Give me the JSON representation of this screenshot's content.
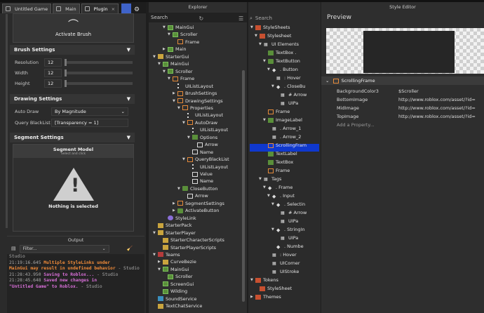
{
  "doc_tabs": [
    "Untitled Game",
    "Main",
    "Plugin"
  ],
  "brush": {
    "activate_label": "Activate Brush"
  },
  "sections": {
    "brush_settings": "Brush Settings",
    "drawing_settings": "Drawing Settings",
    "segment_settings": "Segment Settings"
  },
  "brush_settings": [
    {
      "label": "Resolution",
      "value": "12"
    },
    {
      "label": "Width",
      "value": "12"
    },
    {
      "label": "Height",
      "value": "12"
    }
  ],
  "drawing_settings": {
    "auto_draw_label": "Auto Draw",
    "auto_draw_value": "By Magnitude",
    "query_label": "Query BlackList",
    "query_value": "[Transparency = 1]"
  },
  "segment": {
    "title": "Segment Model",
    "subtitle": "Select and click",
    "empty": "Nothing is selected"
  },
  "output": {
    "title": "Output",
    "filter_placeholder": "Filter...",
    "log": [
      {
        "c": "g",
        "t": "Studio"
      },
      {
        "c": "g",
        "t": "  21:19:16.645  "
      },
      {
        "c": "o",
        "t": "Multiple StyleLinks under"
      },
      {
        "c": "o",
        "t": "MainGui may result in undefined behavior"
      },
      {
        "c": "g",
        "t": "  -  Studio"
      },
      {
        "c": "g",
        "t": "  21:28:43.950  "
      },
      {
        "c": "p",
        "t": "Saving to Roblox..."
      },
      {
        "c": "g",
        "t": "  -  Studio"
      },
      {
        "c": "g",
        "t": "  21:28:45.648  "
      },
      {
        "c": "p",
        "t": "Saved new changes in"
      },
      {
        "c": "p",
        "t": "\"Untitled Game\" to Roblox."
      },
      {
        "c": "g",
        "t": "  -  Studio"
      }
    ]
  },
  "explorer": {
    "title": "Explorer",
    "search_placeholder": "Search",
    "items": [
      {
        "d": 2,
        "a": "v",
        "i": "gui",
        "t": "MainGui"
      },
      {
        "d": 3,
        "a": "v",
        "i": "gui",
        "t": "Scroller"
      },
      {
        "d": 4,
        "a": "",
        "i": "frame",
        "t": "Frame"
      },
      {
        "d": 2,
        "a": ">",
        "i": "gui",
        "t": "Main"
      },
      {
        "d": 0,
        "a": "v",
        "i": "folder",
        "t": "StarterGui"
      },
      {
        "d": 1,
        "a": "v",
        "i": "gui",
        "t": "MainGui"
      },
      {
        "d": 2,
        "a": "v",
        "i": "gui",
        "t": "Scroller"
      },
      {
        "d": 3,
        "a": "v",
        "i": "frame",
        "t": "Frame"
      },
      {
        "d": 4,
        "a": "",
        "i": "list",
        "t": "UIListLayout"
      },
      {
        "d": 4,
        "a": ">",
        "i": "frame",
        "t": "BrushSettings"
      },
      {
        "d": 4,
        "a": "v",
        "i": "frame",
        "t": "DrawingSettings"
      },
      {
        "d": 5,
        "a": "v",
        "i": "frame",
        "t": "Properties"
      },
      {
        "d": 6,
        "a": "",
        "i": "list",
        "t": "UIListLayout"
      },
      {
        "d": 6,
        "a": "v",
        "i": "frame",
        "t": "AutoDraw"
      },
      {
        "d": 7,
        "a": "",
        "i": "list",
        "t": "UIListLayout"
      },
      {
        "d": 7,
        "a": "v",
        "i": "lbl",
        "t": "Options"
      },
      {
        "d": 8,
        "a": "",
        "i": "val",
        "t": "Arrow"
      },
      {
        "d": 7,
        "a": "",
        "i": "val",
        "t": "Name"
      },
      {
        "d": 6,
        "a": "v",
        "i": "frame",
        "t": "QueryBlackList"
      },
      {
        "d": 7,
        "a": "",
        "i": "list",
        "t": "UIListLayout"
      },
      {
        "d": 7,
        "a": "",
        "i": "val",
        "t": "Value"
      },
      {
        "d": 7,
        "a": "",
        "i": "val",
        "t": "Name"
      },
      {
        "d": 5,
        "a": "v",
        "i": "btn",
        "t": "CloseButton"
      },
      {
        "d": 6,
        "a": "",
        "i": "val",
        "t": "Arrow"
      },
      {
        "d": 4,
        "a": ">",
        "i": "frame",
        "t": "SegmentSettings"
      },
      {
        "d": 4,
        "a": ">",
        "i": "btn",
        "t": "ActivateButton"
      },
      {
        "d": 2,
        "a": "",
        "i": "link",
        "t": "StyleLink"
      },
      {
        "d": 0,
        "a": "",
        "i": "folder",
        "t": "StarterPack"
      },
      {
        "d": 0,
        "a": "v",
        "i": "folder",
        "t": "StarterPlayer"
      },
      {
        "d": 1,
        "a": "",
        "i": "folder",
        "t": "StarterCharacterScripts"
      },
      {
        "d": 1,
        "a": "",
        "i": "folder",
        "t": "StarterPlayerScripts"
      },
      {
        "d": 0,
        "a": "v",
        "i": "svc",
        "t": "Teams"
      },
      {
        "d": 1,
        "a": ">",
        "i": "folder",
        "t": "CurveBezie"
      },
      {
        "d": 1,
        "a": "v",
        "i": "gui",
        "t": "MainGui"
      },
      {
        "d": 2,
        "a": "",
        "i": "gui",
        "t": "Scroller"
      },
      {
        "d": 1,
        "a": "",
        "i": "gui",
        "t": "ScreenGui"
      },
      {
        "d": 1,
        "a": "",
        "i": "gui",
        "t": "Wilding"
      },
      {
        "d": 0,
        "a": "",
        "i": "wrld",
        "t": "SoundService"
      },
      {
        "d": 0,
        "a": "",
        "i": "txt",
        "t": "TextChatService"
      }
    ]
  },
  "stylesheets": {
    "search_placeholder": "Search",
    "items": [
      {
        "d": 0,
        "a": "v",
        "i": "ss",
        "t": "StyleSheets"
      },
      {
        "d": 1,
        "a": "v",
        "i": "ss",
        "t": "Stylesheet"
      },
      {
        "d": 2,
        "a": "v",
        "i": "style",
        "t": "UI Elements"
      },
      {
        "d": 3,
        "a": "",
        "i": "lbl",
        "t": "TextBox ."
      },
      {
        "d": 3,
        "a": "v",
        "i": "btn",
        "t": "TextButton"
      },
      {
        "d": 4,
        "a": "v",
        "i": "tag",
        "t": ". Button"
      },
      {
        "d": 5,
        "a": "",
        "i": "style",
        "t": ": Hover"
      },
      {
        "d": 5,
        "a": "v",
        "i": "tag",
        "t": ". CloseBu"
      },
      {
        "d": 6,
        "a": "",
        "i": "style",
        "t": "# Arrow"
      },
      {
        "d": 6,
        "a": "",
        "i": "style",
        "t": "UIPa"
      },
      {
        "d": 3,
        "a": "",
        "i": "frame",
        "t": "Frame"
      },
      {
        "d": 3,
        "a": "v",
        "i": "lbl",
        "t": "ImageLabel"
      },
      {
        "d": 4,
        "a": "",
        "i": "style",
        "t": ". Arrow_1"
      },
      {
        "d": 4,
        "a": "",
        "i": "style",
        "t": ". Arrow_2"
      },
      {
        "d": 3,
        "a": "",
        "i": "frame",
        "t": "ScrollingFram"
      },
      {
        "d": 3,
        "a": "",
        "i": "lbl",
        "t": "TextLabel"
      },
      {
        "d": 3,
        "a": "",
        "i": "lbl",
        "t": "TextBox"
      },
      {
        "d": 3,
        "a": "",
        "i": "frame",
        "t": "Frame"
      },
      {
        "d": 2,
        "a": "v",
        "i": "style",
        "t": "Tags"
      },
      {
        "d": 3,
        "a": "v",
        "i": "tag",
        "t": ". Frame"
      },
      {
        "d": 4,
        "a": "v",
        "i": "tag",
        "t": ". Input"
      },
      {
        "d": 5,
        "a": "v",
        "i": "tag",
        "t": ". Selectin"
      },
      {
        "d": 6,
        "a": "",
        "i": "style",
        "t": "# Arrow"
      },
      {
        "d": 6,
        "a": "",
        "i": "style",
        "t": "UIPa"
      },
      {
        "d": 5,
        "a": "v",
        "i": "tag",
        "t": ". StringIn"
      },
      {
        "d": 6,
        "a": "",
        "i": "style",
        "t": "UIPa"
      },
      {
        "d": 5,
        "a": "",
        "i": "tag",
        "t": ". Numbe"
      },
      {
        "d": 4,
        "a": "",
        "i": "style",
        "t": ": Hover"
      },
      {
        "d": 4,
        "a": "",
        "i": "style",
        "t": "UICorner"
      },
      {
        "d": 4,
        "a": "",
        "i": "style",
        "t": "UIStroke"
      },
      {
        "d": 0,
        "a": "v",
        "i": "ss",
        "t": "Tokens"
      },
      {
        "d": 1,
        "a": "",
        "i": "ss",
        "t": "StyleSheet"
      },
      {
        "d": 0,
        "a": ">",
        "i": "ss",
        "t": "Themes"
      }
    ]
  },
  "style_editor": {
    "title": "Style Editor",
    "preview": "Preview",
    "selected": "ScrollingFrame",
    "props": [
      {
        "k": "BackgroundColor3",
        "v": "$Scroller"
      },
      {
        "k": "BottomImage",
        "v": "http://www.roblox.com/asset/?id="
      },
      {
        "k": "MidImage",
        "v": "http://www.roblox.com/asset/?id="
      },
      {
        "k": "TopImage",
        "v": "http://www.roblox.com/asset/?id="
      }
    ],
    "add_property": "Add a Property..."
  }
}
